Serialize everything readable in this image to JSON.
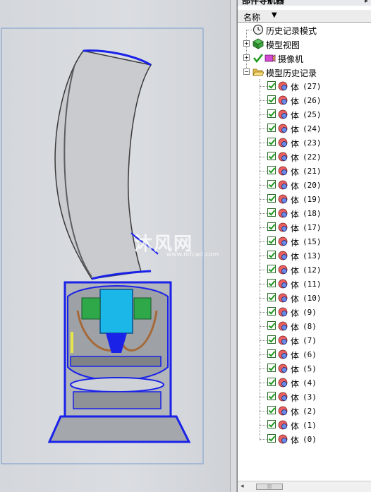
{
  "viewport": {
    "watermark_text": "沐风网",
    "watermark_url": "www.mfcad.com"
  },
  "navigator": {
    "title": "部件导航器",
    "column_name": "名称",
    "history_mode": "历史记录模式",
    "model_views": "模型视图",
    "cameras": "摄像机",
    "model_history": "模型历史记录",
    "body_label": "体",
    "bodies": [
      "(27)",
      "(26)",
      "(25)",
      "(24)",
      "(23)",
      "(22)",
      "(21)",
      "(20)",
      "(19)",
      "(18)",
      "(17)",
      "(15)",
      "(13)",
      "(12)",
      "(11)",
      "(10)",
      "(9)",
      "(8)",
      "(7)",
      "(6)",
      "(5)",
      "(4)",
      "(3)",
      "(2)",
      "(1)",
      "(0)"
    ]
  },
  "colors": {
    "selection_blue": "#1a22e8",
    "motor_cyan": "#1ab7e8",
    "check_green": "#1a9a1a"
  }
}
